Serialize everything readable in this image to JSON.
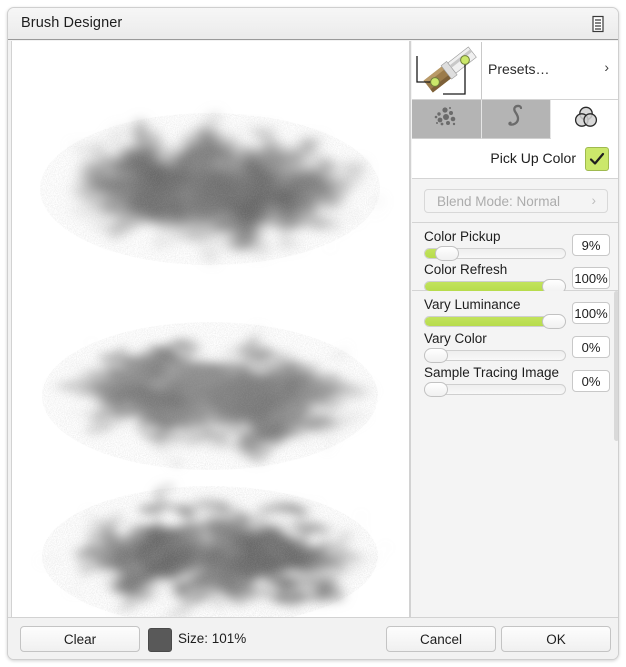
{
  "window": {
    "title": "Brush Designer",
    "menu_icon": "list-menu-icon"
  },
  "canvas": {
    "name": "brush-preview-canvas",
    "strokes": 3,
    "stroke_color": "#6e6e6e",
    "background": "#ffffff"
  },
  "panel": {
    "presets": {
      "label": "Presets…",
      "chevron": "›",
      "thumb_icon": "paintbrush-icon"
    },
    "tabs": [
      {
        "name": "tab-scatter",
        "icon": "scatter-dots-icon",
        "active": false
      },
      {
        "name": "tab-curve",
        "icon": "s-curve-icon",
        "active": false
      },
      {
        "name": "tab-color",
        "icon": "color-circles-icon",
        "active": true
      }
    ],
    "pick_up_color": {
      "label": "Pick Up Color",
      "checked": true,
      "check_glyph": "✓",
      "accent": "#cbe86b"
    },
    "blend_mode": {
      "label": "Blend Mode: Normal",
      "chevron": "›",
      "disabled": true
    },
    "sliders": [
      {
        "name": "color-pickup",
        "label": "Color Pickup",
        "value": "9%",
        "percent": 9
      },
      {
        "name": "color-refresh",
        "label": "Color Refresh",
        "value": "100%",
        "percent": 100
      },
      {
        "name": "vary-luminance",
        "label": "Vary Luminance",
        "value": "100%",
        "percent": 100
      },
      {
        "name": "vary-color",
        "label": "Vary Color",
        "value": "0%",
        "percent": 0
      },
      {
        "name": "sample-tracing-image",
        "label": "Sample Tracing Image",
        "value": "0%",
        "percent": 0
      }
    ]
  },
  "footer": {
    "clear_label": "Clear",
    "size_label": "Size: 101%",
    "swatch_color": "#595959",
    "cancel_label": "Cancel",
    "ok_label": "OK"
  },
  "colors": {
    "accent_green": "#cbe86b",
    "slider_green": "#bede50",
    "panel_bg": "#f4f4f4",
    "tab_inactive": "#b4b4b4"
  }
}
